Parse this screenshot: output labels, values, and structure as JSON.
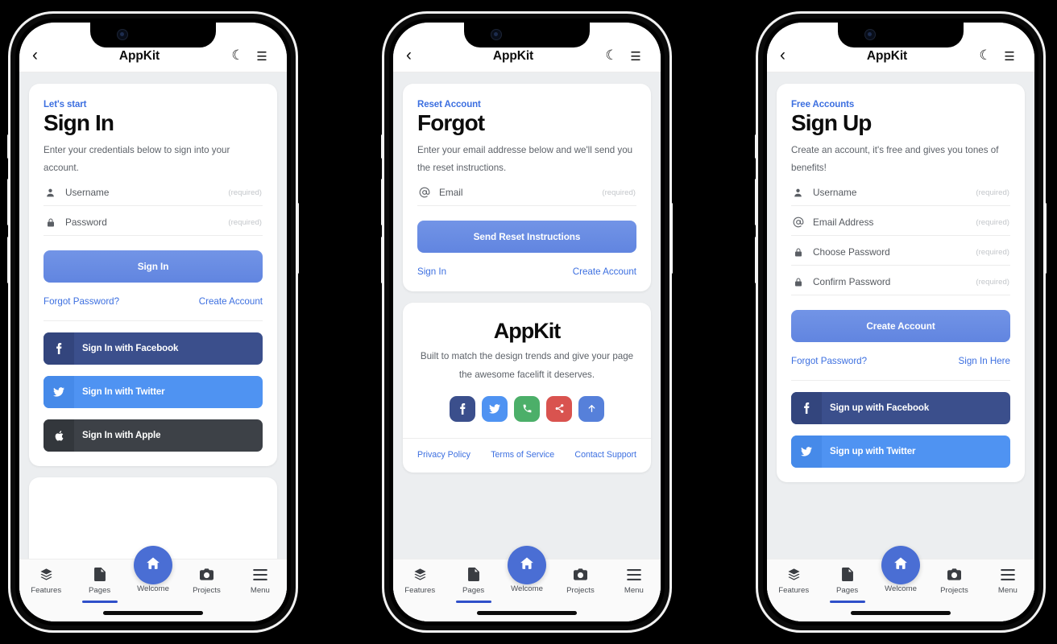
{
  "app": {
    "title": "AppKit",
    "header_icons": {
      "back": "chevron-left-icon",
      "dark_mode": "moon-icon",
      "menu": "hamburger-icon"
    }
  },
  "required_tag": "(required)",
  "colors": {
    "accent_blue": "#3c6fe0",
    "primary_button": "#6185e0",
    "fab_blue": "#4a6ed4",
    "facebook": "#3b4f8c",
    "twitter": "#4f93f2",
    "apple": "#3d4147",
    "phone_green": "#4caf69",
    "share_red": "#d9534f",
    "page_bg": "#eceef0",
    "card_bg": "#ffffff"
  },
  "screens": [
    {
      "id": "signin",
      "card": {
        "eyebrow": "Let's start",
        "title": "Sign In",
        "lead": "Enter your credentials below to sign into your account.",
        "fields": [
          {
            "icon": "person-icon",
            "label": "Username",
            "value": "",
            "required": "(required)"
          },
          {
            "icon": "lock-icon",
            "label": "Password",
            "value": "",
            "required": "(required)"
          }
        ],
        "primary_button": "Sign In",
        "links": [
          {
            "label": "Forgot Password?",
            "align": "left"
          },
          {
            "label": "Create Account",
            "align": "right"
          }
        ],
        "social_buttons": [
          {
            "provider": "facebook",
            "icon": "facebook-icon",
            "label": "Sign In with Facebook"
          },
          {
            "provider": "twitter",
            "icon": "twitter-icon",
            "label": "Sign In with Twitter"
          },
          {
            "provider": "apple",
            "icon": "apple-icon",
            "label": "Sign In with Apple"
          }
        ]
      }
    },
    {
      "id": "forgot",
      "card": {
        "eyebrow": "Reset Account",
        "title": "Forgot",
        "lead": "Enter your email addresse below and we'll send you the reset instructions.",
        "fields": [
          {
            "icon": "at-icon",
            "label": "Email",
            "value": "",
            "required": "(required)"
          }
        ],
        "primary_button": "Send Reset Instructions",
        "links": [
          {
            "label": "Sign In",
            "align": "left"
          },
          {
            "label": "Create Account",
            "align": "right"
          }
        ]
      },
      "promo": {
        "title": "AppKit",
        "text": "Built to match the design trends and give your page the awesome facelift it deserves.",
        "social_icons": [
          {
            "name": "facebook-icon",
            "color": "#3b4f8c"
          },
          {
            "name": "twitter-icon",
            "color": "#4f93f2"
          },
          {
            "name": "phone-icon",
            "color": "#4caf69"
          },
          {
            "name": "share-icon",
            "color": "#d9534f"
          },
          {
            "name": "arrow-up-icon",
            "color": "#5680da"
          }
        ],
        "footer_links": [
          "Privacy Policy",
          "Terms of Service",
          "Contact Support"
        ]
      }
    },
    {
      "id": "signup",
      "card": {
        "eyebrow": "Free Accounts",
        "title": "Sign Up",
        "lead": "Create an account, it's free and gives you tones of benefits!",
        "fields": [
          {
            "icon": "person-icon",
            "label": "Username",
            "value": "",
            "required": "(required)"
          },
          {
            "icon": "at-icon",
            "label": "Email Address",
            "value": "",
            "required": "(required)"
          },
          {
            "icon": "lock-icon",
            "label": "Choose Password",
            "value": "",
            "required": "(required)"
          },
          {
            "icon": "lock-icon",
            "label": "Confirm Password",
            "value": "",
            "required": "(required)"
          }
        ],
        "primary_button": "Create Account",
        "links": [
          {
            "label": "Forgot Password?",
            "align": "left"
          },
          {
            "label": "Sign In Here",
            "align": "right"
          }
        ],
        "social_buttons": [
          {
            "provider": "facebook",
            "icon": "facebook-icon",
            "label": "Sign up with Facebook"
          },
          {
            "provider": "twitter",
            "icon": "twitter-icon",
            "label": "Sign up with Twitter"
          }
        ]
      }
    }
  ],
  "tabbar": {
    "items": [
      {
        "label": "Features",
        "icon": "layers-icon",
        "active": false
      },
      {
        "label": "Pages",
        "icon": "document-icon",
        "active": true
      },
      {
        "label": "Welcome",
        "icon": "home-icon",
        "active": false,
        "elevated": true
      },
      {
        "label": "Projects",
        "icon": "camera-icon",
        "active": false
      },
      {
        "label": "Menu",
        "icon": "hamburger-icon",
        "active": false
      }
    ]
  }
}
